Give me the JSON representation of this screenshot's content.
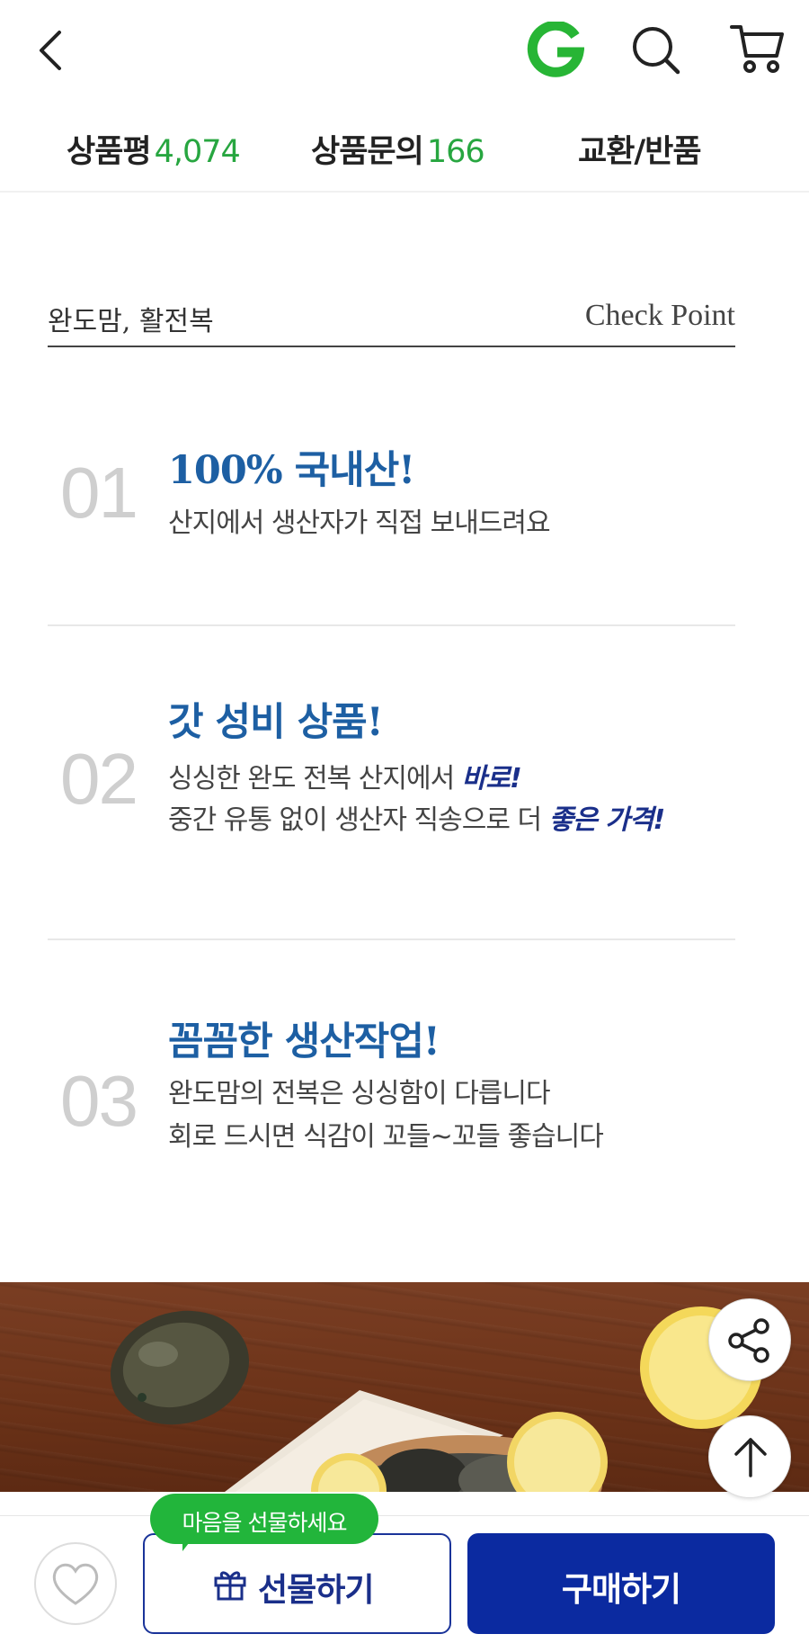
{
  "header": {
    "back_icon": "chevron-left-icon",
    "logo_icon": "g-logo-icon",
    "search_icon": "search-icon",
    "cart_icon": "cart-icon",
    "brand_color": "#27a640"
  },
  "tabs": [
    {
      "label": "상품평",
      "count": "4,074"
    },
    {
      "label": "상품문의",
      "count": "166"
    },
    {
      "label": "교환/반품",
      "count": ""
    }
  ],
  "content": {
    "brand_title": "완도맘, 활전복",
    "check_point": "Check Point",
    "points": [
      {
        "num": "01",
        "title": "100% 국내산!",
        "lines": [
          {
            "text": "산지에서 생산자가 직접 보내드려요",
            "emphasis": ""
          }
        ]
      },
      {
        "num": "02",
        "title": "갓 성비 상품!",
        "lines": [
          {
            "text": "싱싱한 완도 전복 산지에서 ",
            "emphasis": "바로!"
          },
          {
            "text": "중간 유통 없이 생산자 직송으로 더 ",
            "emphasis": "좋은 가격!"
          }
        ]
      },
      {
        "num": "03",
        "title": "꼼꼼한 생산작업!",
        "lines": [
          {
            "text": "완도맘의 전복은 싱싱함이 다릅니다",
            "emphasis": ""
          },
          {
            "text": "회로 드시면 식감이 꼬들~꼬들 좋습니다",
            "emphasis": ""
          }
        ]
      }
    ],
    "title_color": "#1d5fa3",
    "emphasis_color": "#1a2f8a"
  },
  "floating": {
    "share_icon": "share-icon",
    "scroll_top_icon": "arrow-up-icon"
  },
  "bottom_bar": {
    "wish_icon": "heart-icon",
    "gift_tooltip": "마음을 선물하세요",
    "gift_icon": "gift-icon",
    "gift_label": "선물하기",
    "buy_label": "구매하기",
    "buy_color": "#0b2aa0",
    "tooltip_color": "#22b53b"
  }
}
